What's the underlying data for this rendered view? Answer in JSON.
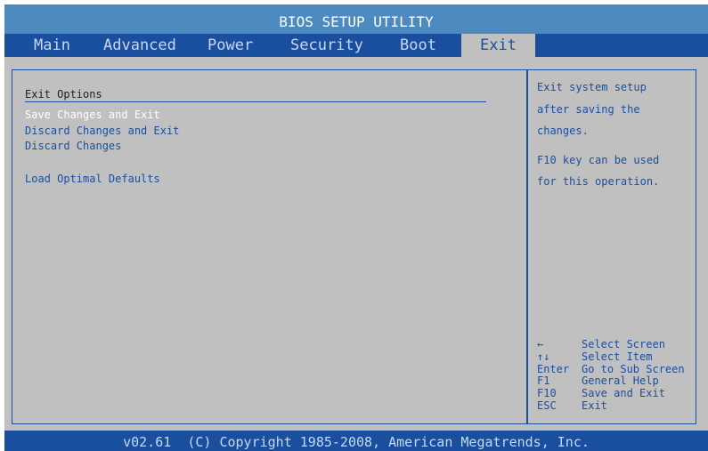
{
  "title": "BIOS SETUP UTILITY",
  "tabs": [
    {
      "label": "Main"
    },
    {
      "label": "Advanced"
    },
    {
      "label": "Power"
    },
    {
      "label": "Security"
    },
    {
      "label": "Boot"
    },
    {
      "label": "Exit",
      "active": true
    }
  ],
  "main": {
    "section_title": "Exit Options",
    "options": [
      {
        "label": "Save Changes and Exit",
        "selected": true
      },
      {
        "label": "Discard Changes and Exit"
      },
      {
        "label": "Discard Changes"
      },
      {
        "label": "Load Optimal Defaults"
      }
    ]
  },
  "help": {
    "description_lines": [
      "Exit system setup",
      "after saving the",
      "changes."
    ],
    "note_lines": [
      "F10 key can be used",
      "for this operation."
    ]
  },
  "keys": [
    {
      "key_icon": "left-arrow-icon",
      "key": "←",
      "action": "Select  Screen"
    },
    {
      "key_icon": "up-down-arrows-icon",
      "key": "↑↓",
      "action": "Select  Item"
    },
    {
      "key": "Enter",
      "action": "Go to Sub Screen"
    },
    {
      "key": "F1",
      "action": "General Help"
    },
    {
      "key": "F10",
      "action": "Save and Exit"
    },
    {
      "key": "ESC",
      "action": "Exit"
    }
  ],
  "footer": "v02.61  (C) Copyright 1985-2008, American Megatrends, Inc.",
  "colors": {
    "title_bar": "#4d8ac0",
    "menu_bar": "#1a4fa0",
    "background": "#c0c0c0",
    "text_blue": "#1a4fa0",
    "highlight": "#ffffff"
  }
}
